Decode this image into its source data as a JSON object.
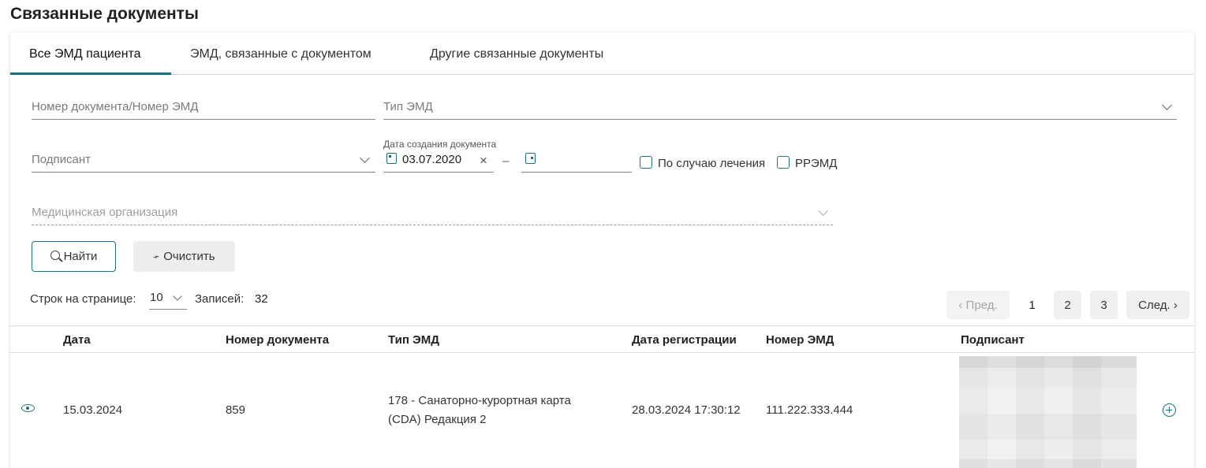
{
  "page": {
    "title": "Связанные документы"
  },
  "tabs": [
    {
      "label": "Все ЭМД пациента",
      "active": true
    },
    {
      "label": "ЭМД, связанные с документом",
      "active": false
    },
    {
      "label": "Другие связанные документы",
      "active": false
    }
  ],
  "filters": {
    "doc_number_placeholder": "Номер документа/Номер ЭМД",
    "emd_type_placeholder": "Тип ЭМД",
    "signer_placeholder": "Подписант",
    "date_label": "Дата создания документа",
    "date_from": "03.07.2020",
    "date_to": "",
    "date_separator": "–",
    "by_case_label": "По случаю лечения",
    "rremd_label": "РРЭМД",
    "med_org_placeholder": "Медицинская организация"
  },
  "buttons": {
    "find": "Найти",
    "clear": "Очистить"
  },
  "pagination": {
    "rows_label": "Строк на странице:",
    "rows_value": "10",
    "records_label": "Записей:",
    "records_value": "32",
    "prev": "‹ Пред.",
    "next": "След. ›",
    "pages": [
      "1",
      "2",
      "3"
    ],
    "current_page": "1"
  },
  "table": {
    "columns": [
      "Дата",
      "Номер документа",
      "Тип ЭМД",
      "Дата регистрации",
      "Номер ЭМД",
      "Подписант"
    ],
    "rows": [
      {
        "date": "15.03.2024",
        "doc_number": "859",
        "emd_type_line1": "178 - Санаторно-курортная карта",
        "emd_type_line2": "(CDA) Редакция 2",
        "reg_date": "28.03.2024 17:30:12",
        "emd_number": "111.222.333.444",
        "signer": ""
      }
    ]
  },
  "icons": {
    "accent_color": "#1f6f7f",
    "list": [
      "calendar-icon",
      "clear-x-icon",
      "chevron-down-icon",
      "search-icon",
      "broom-icon",
      "eye-icon",
      "plus-circle-icon"
    ]
  }
}
